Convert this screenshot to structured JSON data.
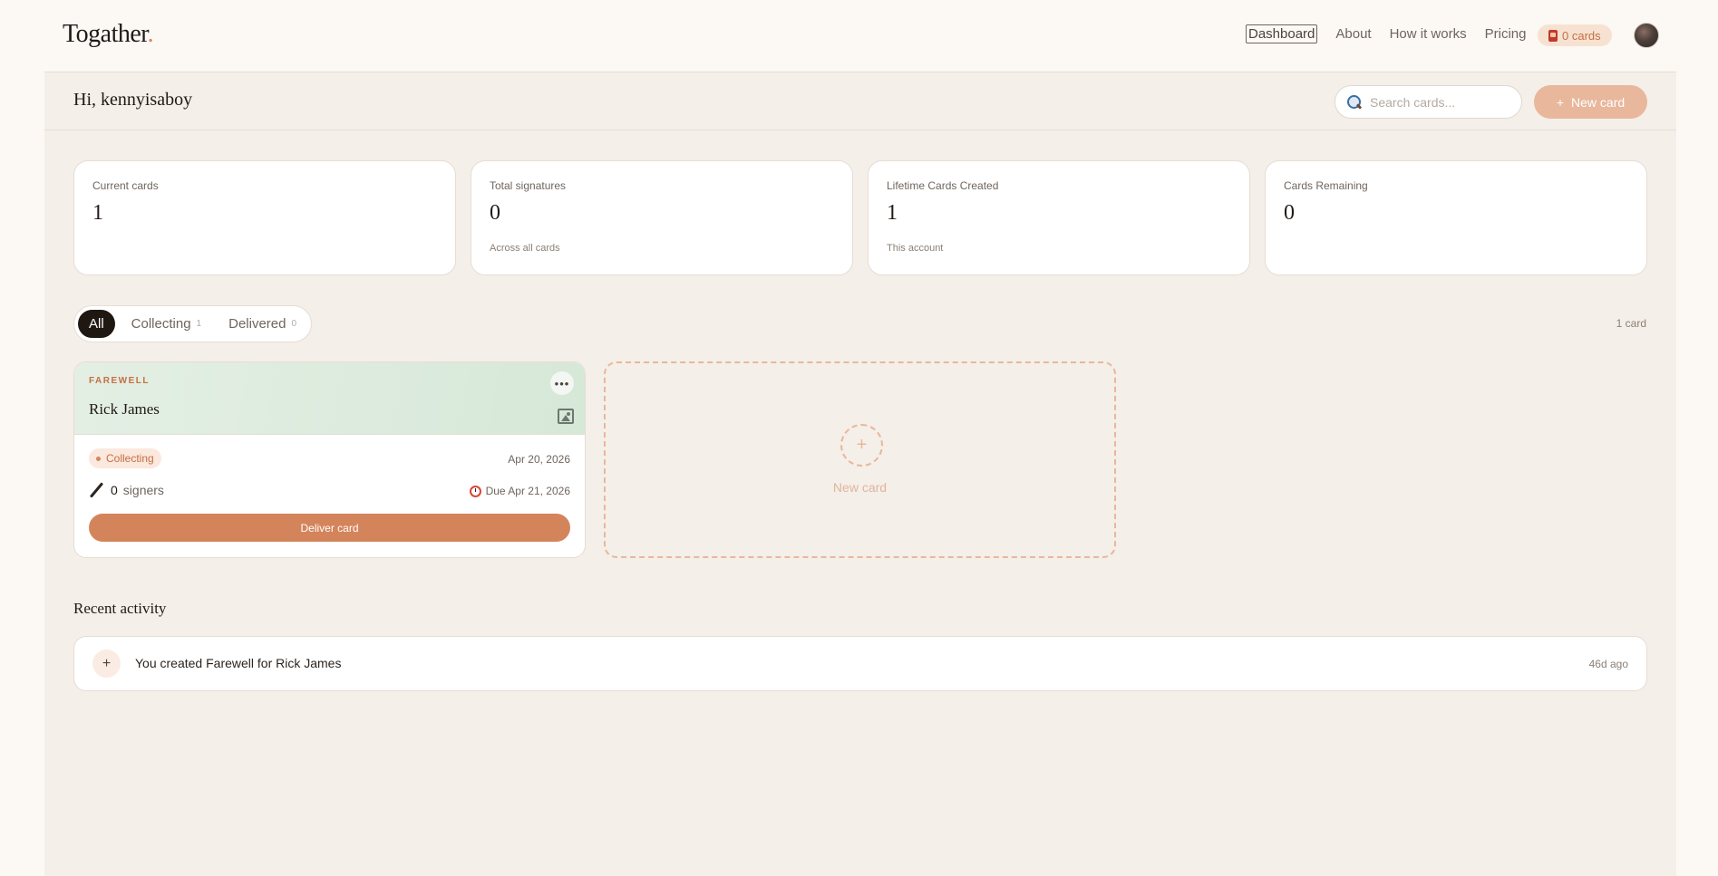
{
  "app": {
    "logo": "Togather",
    "logo_dot": "."
  },
  "nav": {
    "links": [
      "Dashboard",
      "About",
      "How it works",
      "Pricing"
    ],
    "active": "Dashboard",
    "cards_pill": "0 cards"
  },
  "header": {
    "greeting": "Hi, kennyisaboy",
    "search_placeholder": "Search cards...",
    "new_button": "New card",
    "new_button_icon": "+"
  },
  "stats": [
    {
      "label": "Current cards",
      "value": "1",
      "sub": ""
    },
    {
      "label": "Total signatures",
      "value": "0",
      "sub": "Across all cards"
    },
    {
      "label": "Lifetime Cards Created",
      "value": "1",
      "sub": "This account"
    },
    {
      "label": "Cards Remaining",
      "value": "0",
      "sub": ""
    }
  ],
  "filters": {
    "tabs": [
      {
        "label": "All",
        "count": ""
      },
      {
        "label": "Collecting",
        "count": "1"
      },
      {
        "label": "Delivered",
        "count": "0"
      }
    ],
    "active": "All",
    "count_label": "1 card"
  },
  "card": {
    "type": "FAREWELL",
    "name": "Rick James",
    "more": "•••",
    "status": "Collecting",
    "date": "Apr 20, 2026",
    "signers_count": "0",
    "signers_label": "signers",
    "due": "Due Apr 21, 2026",
    "deliver_button": "Deliver card"
  },
  "new_card": {
    "plus": "+",
    "label": "New card"
  },
  "recent": {
    "title": "Recent activity",
    "items": [
      {
        "icon": "+",
        "text": "You created Farewell for Rick James",
        "time": "46d ago"
      }
    ]
  },
  "colors": {
    "accent": "#d4845b",
    "accent_light": "#e8b79c",
    "background": "#fcf8f4",
    "panel": "#f4efe8",
    "dark": "#1f1712"
  },
  "icons": {
    "search": "search-icon",
    "cards_pill": "card-icon",
    "more": "more-icon",
    "image": "image-icon",
    "pen": "pen-icon",
    "clock": "alarm-clock-icon"
  }
}
